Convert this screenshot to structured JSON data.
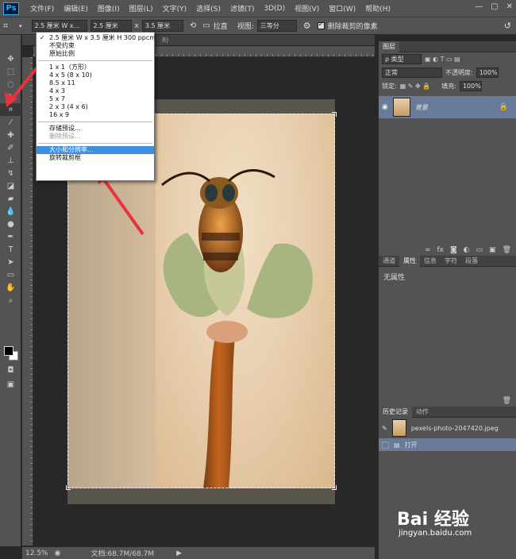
{
  "app": {
    "logo": "Ps"
  },
  "menu": [
    "文件(F)",
    "编辑(E)",
    "图像(I)",
    "图层(L)",
    "文字(Y)",
    "选择(S)",
    "滤镜(T)",
    "3D(D)",
    "视图(V)",
    "窗口(W)",
    "帮助(H)"
  ],
  "window_controls": {
    "minimize": "—",
    "restore": "▢",
    "close": "✕"
  },
  "options": {
    "preset_value": "2.5 厘米 W x...",
    "width_value": "2.5 厘米",
    "x_label": "x",
    "height_value": "3.5 厘米",
    "straighten_label": "拉直",
    "view_label": "视图:",
    "view_value": "三等分",
    "delete_pixels_label": "删除裁剪的像素"
  },
  "dropdown": {
    "items_top": [
      {
        "label": "2.5 厘米 W x 3.5 厘米 H 300 ppcm",
        "checked": true
      },
      {
        "label": "不受约束"
      },
      {
        "label": "原始比例"
      }
    ],
    "ratios": [
      "1 x 1（方形）",
      "4 x 5 (8 x 10)",
      "8.5 x 11",
      "4 x 3",
      "5 x 7",
      "2 x 3 (4 x 6)",
      "16 x 9"
    ],
    "preset_actions": [
      {
        "label": "存储预设..."
      },
      {
        "label": "删除预设...",
        "disabled": true
      }
    ],
    "size_actions": [
      {
        "label": "大小和分辨率...",
        "highlight": true
      },
      {
        "label": "旋转裁剪框"
      }
    ]
  },
  "document": {
    "tab_suffix": "8)"
  },
  "status": {
    "zoom": "12.5%",
    "doc_size": "文档:68.7M/68.7M"
  },
  "layers_panel": {
    "tab": "图层",
    "filter_label": "ρ 类型",
    "blend_mode": "正常",
    "opacity_label": "不透明度:",
    "opacity_value": "100%",
    "lock_label": "锁定:",
    "fill_label": "填充:",
    "fill_value": "100%",
    "layer_name": "背景"
  },
  "props_panel": {
    "tabs": [
      "通道",
      "属性",
      "信息",
      "字符",
      "段落"
    ],
    "active_tab": "属性",
    "content": "无属性"
  },
  "history_panel": {
    "tabs": [
      "历史记录",
      "动作"
    ],
    "snapshot": "pexels-photo-2047420.jpeg",
    "step": "打开"
  },
  "watermark": {
    "main": "Bai 经验",
    "sub": "jingyan.baidu.com"
  },
  "colors": {
    "highlight": "#3b8fe1",
    "arrow": "#e8323c",
    "layer_selected": "#6a7b9a"
  }
}
